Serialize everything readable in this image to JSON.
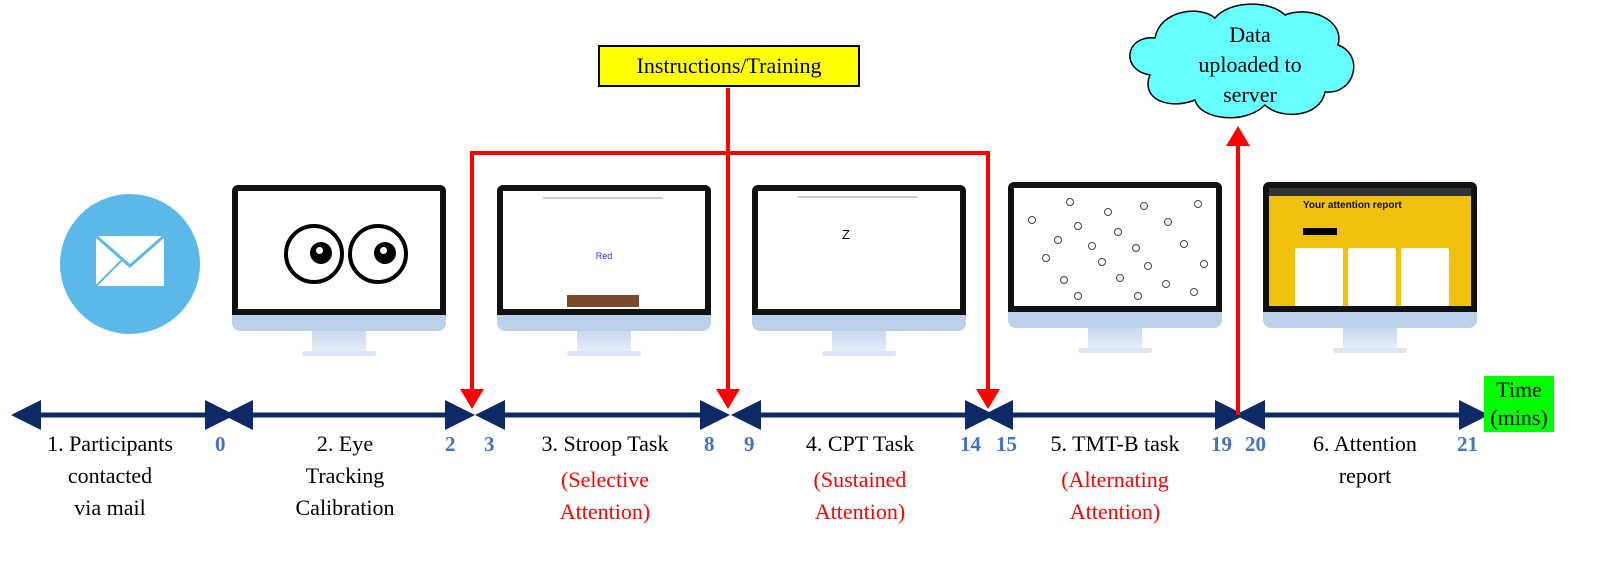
{
  "callout": {
    "instructions": "Instructions/Training",
    "cloud": [
      "Data",
      "uploaded to",
      "server"
    ]
  },
  "time_label": [
    "Time",
    "(mins)"
  ],
  "steps": [
    {
      "label": [
        "1. Participants",
        "contacted",
        "via mail"
      ],
      "icon": "envelope-icon"
    },
    {
      "label": [
        "2. Eye",
        "Tracking",
        "Calibration"
      ],
      "icon": "eyes-monitor"
    },
    {
      "label": [
        "3. Stroop Task"
      ],
      "sub": [
        "(Selective",
        "Attention)"
      ],
      "screen_text": "Red"
    },
    {
      "label": [
        "4. CPT Task"
      ],
      "sub": [
        "(Sustained",
        "Attention)"
      ],
      "screen_text": "Z"
    },
    {
      "label": [
        "5. TMT-B task"
      ],
      "sub": [
        "(Alternating",
        "Attention)"
      ]
    },
    {
      "label": [
        "6. Attention",
        "report"
      ],
      "screen_title": "Your attention report"
    }
  ],
  "ticks": [
    "0",
    "2",
    "3",
    "8",
    "9",
    "14",
    "15",
    "19",
    "20",
    "21"
  ],
  "colors": {
    "timeline": "#0e2a66",
    "arrow": "#ff0000",
    "tick": "#4472c4",
    "callout": "#ffff00",
    "cloud": "#66ffff",
    "time": "#00ff00",
    "report": "#f0c20e"
  }
}
